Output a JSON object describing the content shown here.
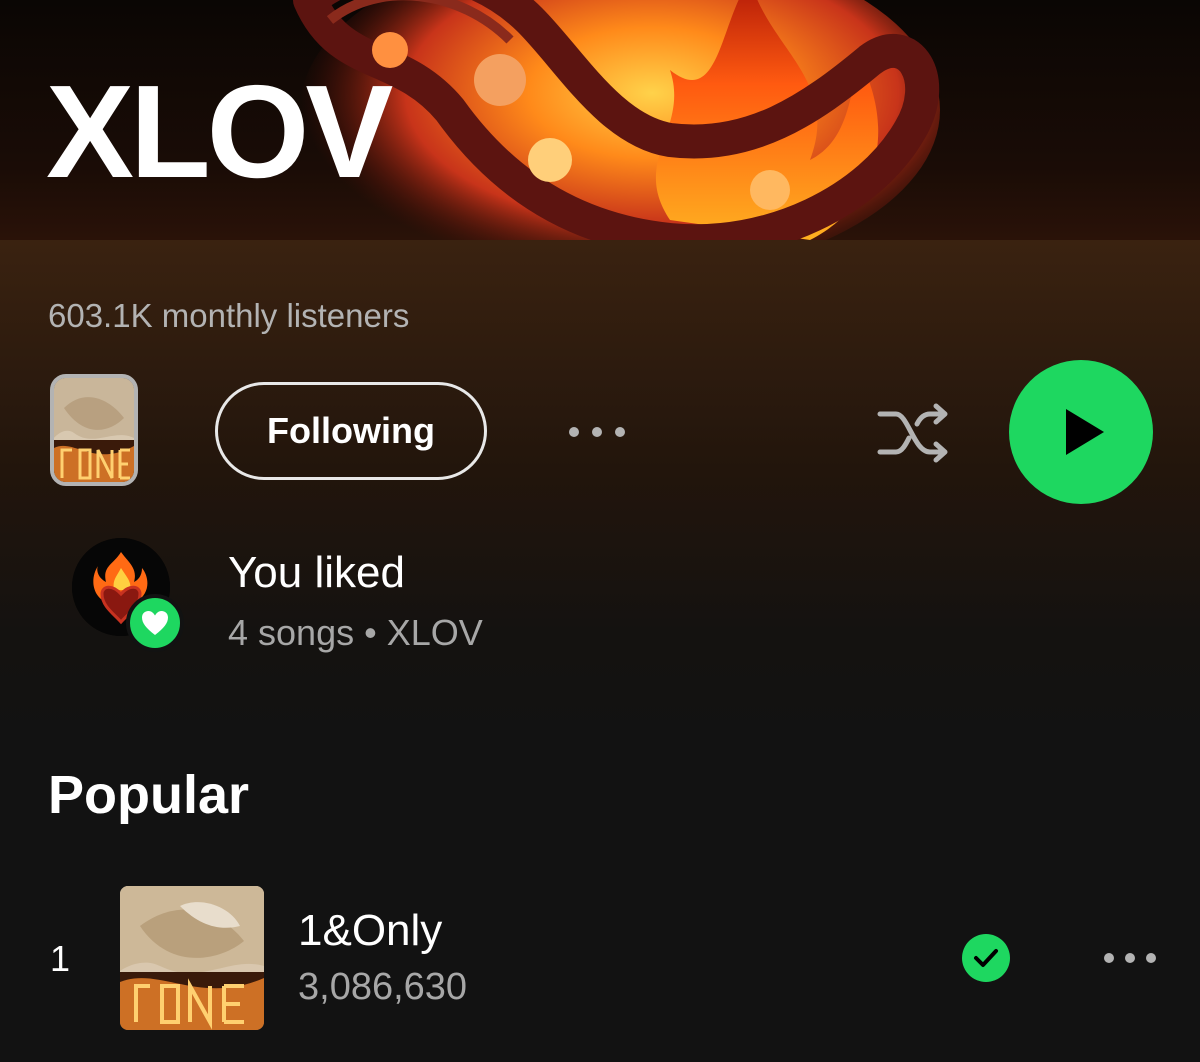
{
  "artist": {
    "name": "XLOV",
    "monthly_listeners": "603.1K monthly listeners"
  },
  "actions": {
    "follow_label": "Following",
    "more_icon": "more-horizontal-icon",
    "shuffle_icon": "shuffle-icon",
    "play_icon": "play-icon"
  },
  "liked": {
    "title": "You liked",
    "subtitle": "4 songs • XLOV",
    "badge_icon": "heart-icon"
  },
  "popular": {
    "title": "Popular",
    "tracks": [
      {
        "rank": "1",
        "title": "1&Only",
        "plays": "3,086,630",
        "downloaded_icon": "check-circle-icon"
      }
    ]
  },
  "colors": {
    "accent": "#1ed760",
    "background": "#121212",
    "secondary_text": "#a7a7a7"
  }
}
